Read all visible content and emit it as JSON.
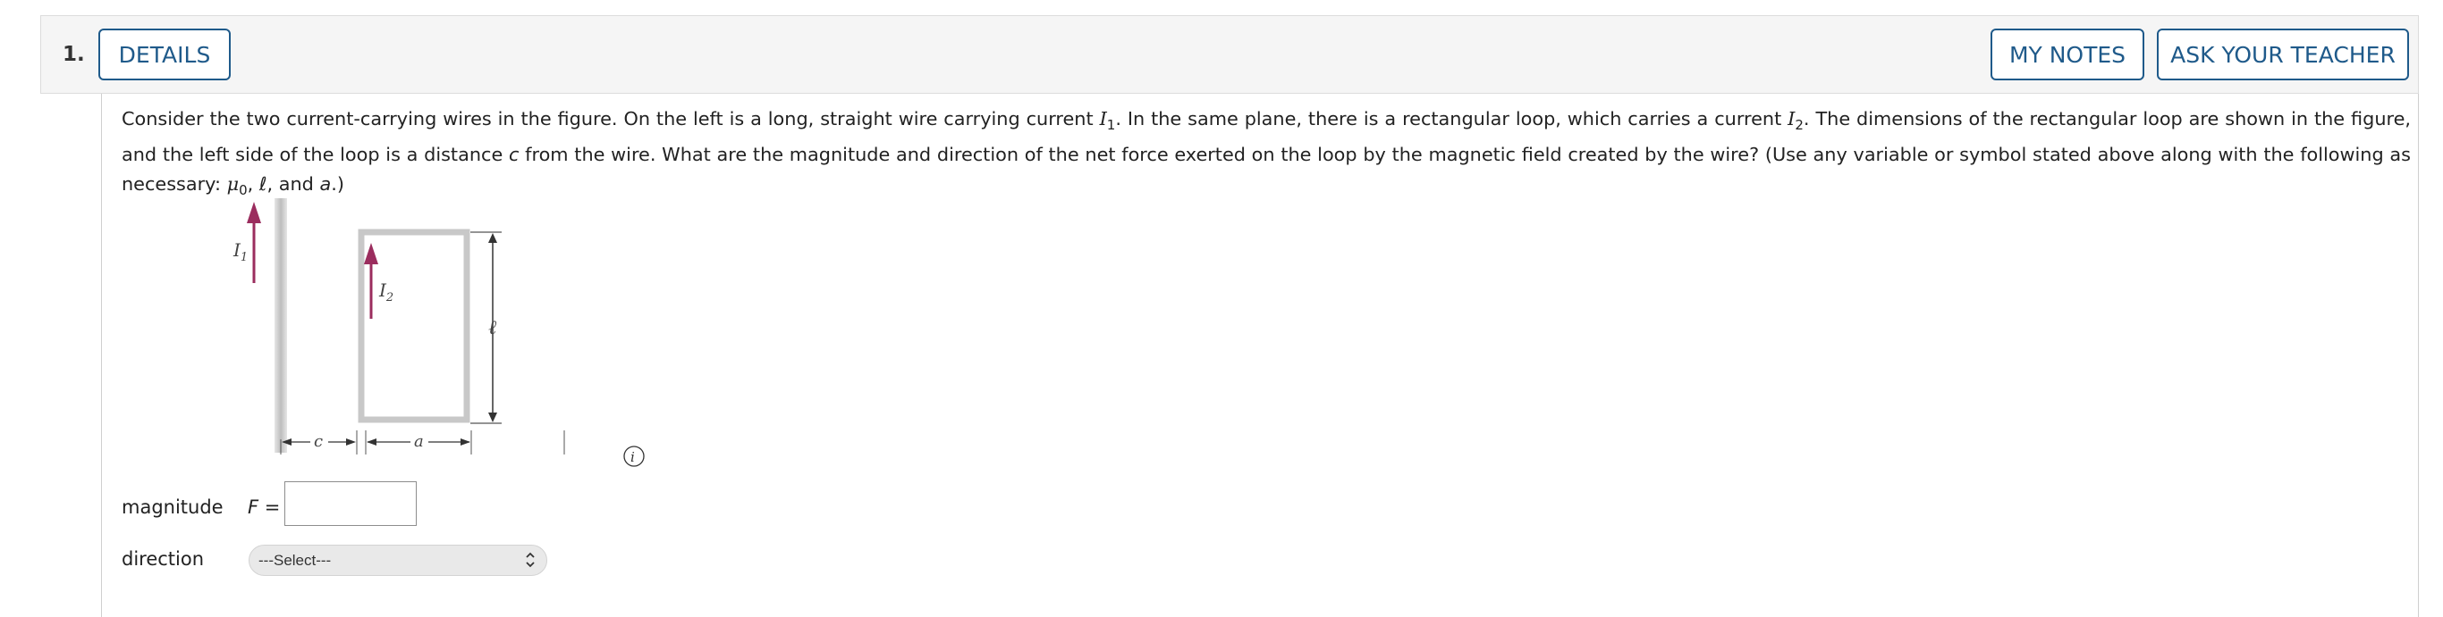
{
  "question": {
    "number": "1.",
    "details_label": "DETAILS",
    "my_notes_label": "MY NOTES",
    "ask_teacher_label": "ASK YOUR TEACHER"
  },
  "problem": {
    "p1": "Consider the two current-carrying wires in the figure. On the left is a long, straight wire carrying current ",
    "i1_sym": "I",
    "i1_sub": "1",
    "p2": ". In the same plane, there is a rectangular loop, which carries a current ",
    "i2_sym": "I",
    "i2_sub": "2",
    "p3": ". The dimensions of the rectangular loop are shown in the figure, and the left side of the loop is a distance ",
    "c_sym": "c",
    "p4": " from the wire. What are the magnitude and direction of the net force exerted on the loop by the magnetic field created by the wire? (Use any variable or symbol stated above along with the following as necessary: ",
    "mu_sym": "μ",
    "mu_sub": "0",
    "p5": ", ",
    "ell_sym": "ℓ",
    "p6": ", and ",
    "a_sym": "a",
    "p7": ".)"
  },
  "figure": {
    "label_i1": "I",
    "label_i1_sub": "1",
    "label_i2": "I",
    "label_i2_sub": "2",
    "label_ell": "ℓ",
    "label_c": "c",
    "label_a": "a",
    "info_icon": "info-icon",
    "colors": {
      "arrow": "#9b2d5e",
      "wire": "#cfcfcf",
      "loop": "#c8c8c8"
    }
  },
  "answers": {
    "magnitude_label": "magnitude",
    "f_label": "F",
    "f_equals": " =",
    "magnitude_value": "",
    "direction_label": "direction",
    "direction_selected": "---Select---"
  }
}
